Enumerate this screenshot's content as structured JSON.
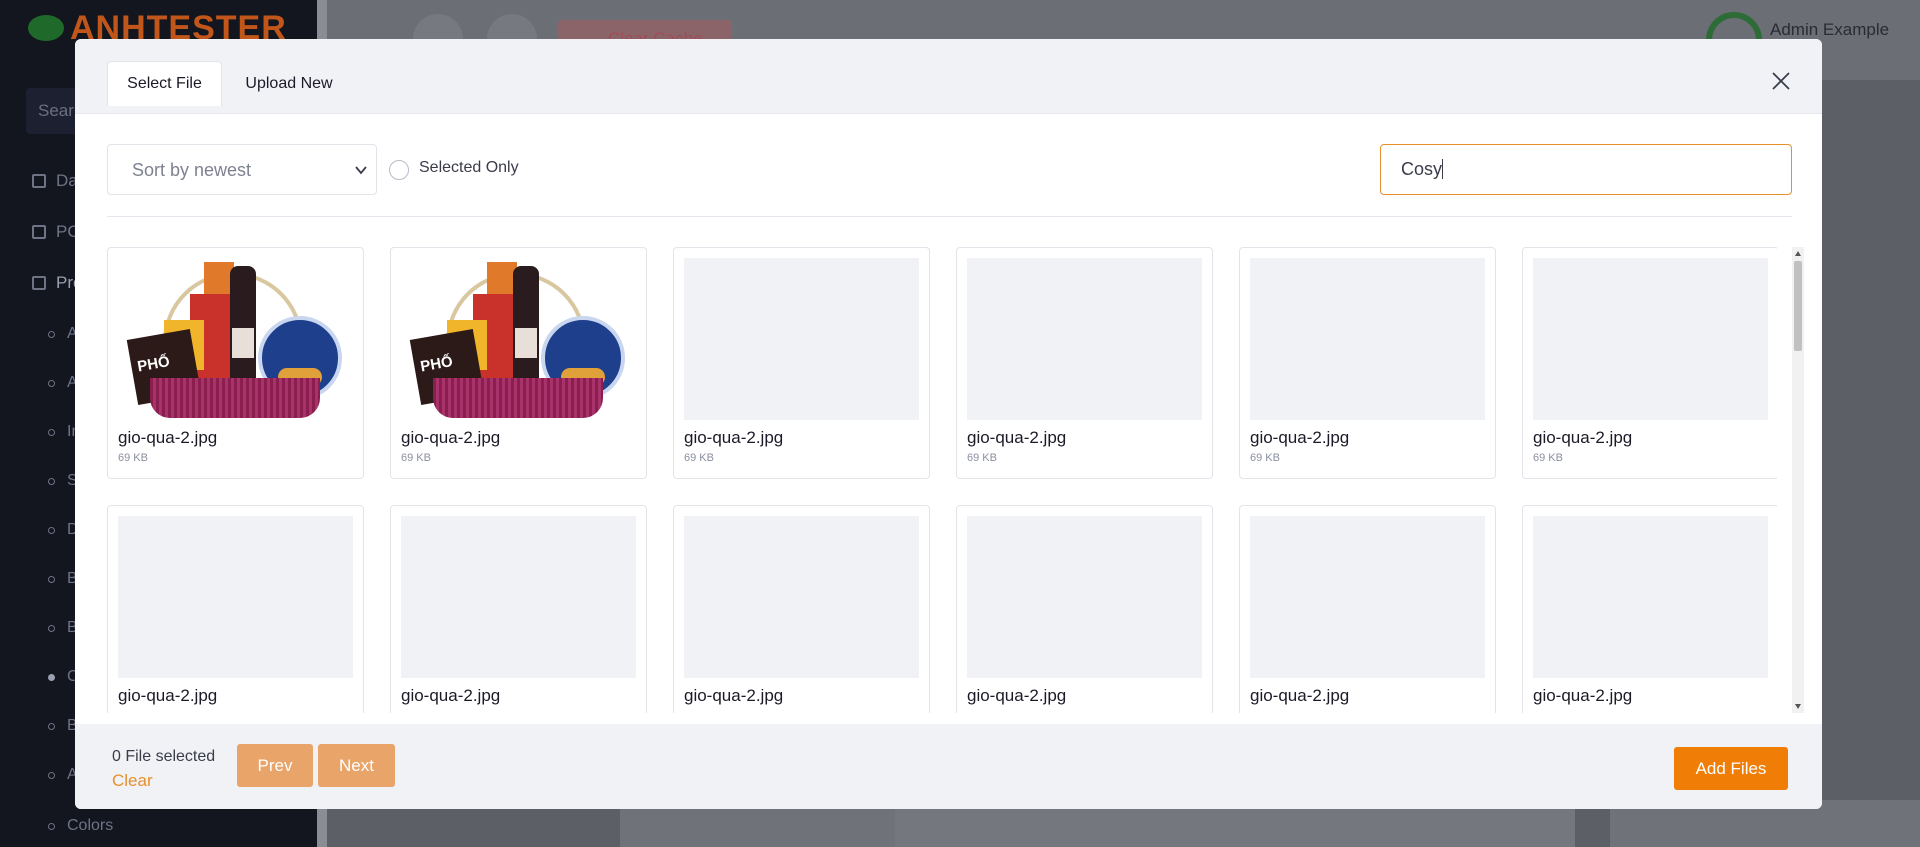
{
  "background": {
    "logo_text": "ANHTESTER",
    "search_placeholder": "Sear",
    "nav": [
      "Da",
      "PO",
      "Pro"
    ],
    "subnav": [
      "A",
      "A",
      "In",
      "S",
      "D",
      "B",
      "B",
      "C",
      "B",
      "A",
      "Colors"
    ],
    "clear_cache_label": "Clear Cache",
    "user_name": "Admin Example"
  },
  "modal": {
    "tabs": [
      {
        "label": "Select File",
        "active": true
      },
      {
        "label": "Upload New",
        "active": false
      }
    ],
    "sort_select": {
      "value": "Sort by newest"
    },
    "selected_only_label": "Selected Only",
    "search": {
      "value": "Cosy"
    },
    "files": [
      {
        "name": "gio-qua-2.jpg",
        "size": "69 KB",
        "has_preview": true
      },
      {
        "name": "gio-qua-2.jpg",
        "size": "69 KB",
        "has_preview": true
      },
      {
        "name": "gio-qua-2.jpg",
        "size": "69 KB",
        "has_preview": false
      },
      {
        "name": "gio-qua-2.jpg",
        "size": "69 KB",
        "has_preview": false
      },
      {
        "name": "gio-qua-2.jpg",
        "size": "69 KB",
        "has_preview": false
      },
      {
        "name": "gio-qua-2.jpg",
        "size": "69 KB",
        "has_preview": false
      },
      {
        "name": "gio-qua-2.jpg",
        "size": "",
        "has_preview": false
      },
      {
        "name": "gio-qua-2.jpg",
        "size": "",
        "has_preview": false
      },
      {
        "name": "gio-qua-2.jpg",
        "size": "",
        "has_preview": false
      },
      {
        "name": "gio-qua-2.jpg",
        "size": "",
        "has_preview": false
      },
      {
        "name": "gio-qua-2.jpg",
        "size": "",
        "has_preview": false
      },
      {
        "name": "gio-qua-2.jpg",
        "size": "",
        "has_preview": false
      }
    ],
    "footer": {
      "selected_count": "0 File selected",
      "clear_label": "Clear",
      "prev_label": "Prev",
      "next_label": "Next",
      "add_files_label": "Add Files"
    }
  },
  "colors": {
    "accent": "#f07d06",
    "accent_soft": "#e9a46a",
    "search_border": "#e8902c"
  }
}
